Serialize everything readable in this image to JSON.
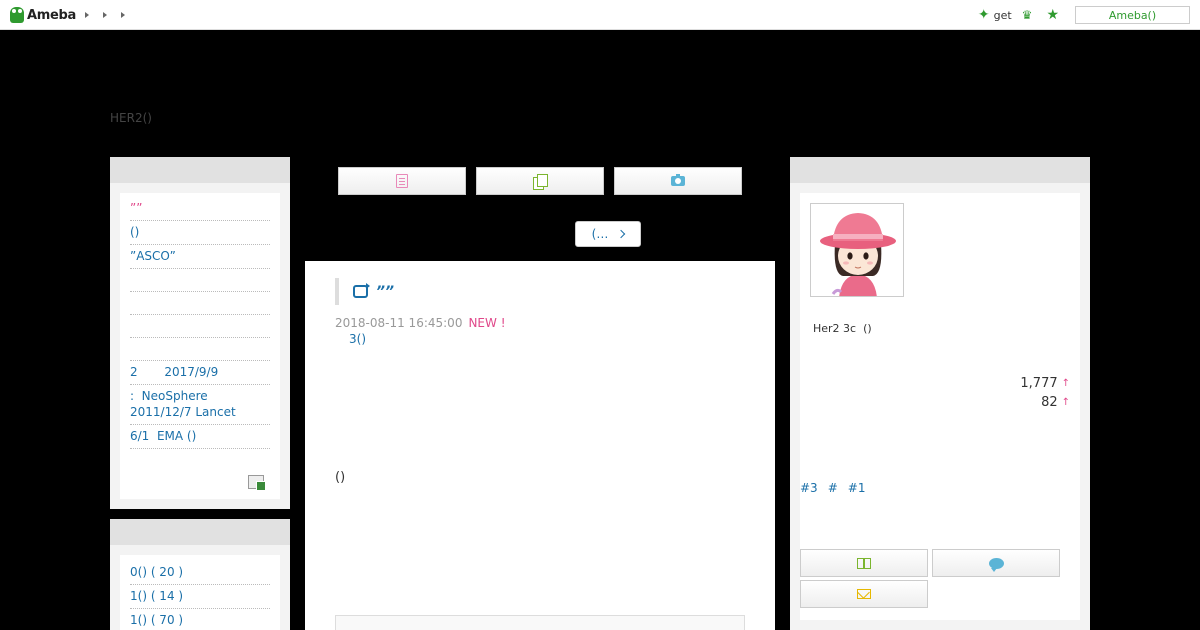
{
  "topbar": {
    "logo_text": "Ameba",
    "get_label": "get",
    "ameba_button_label": "Ameba()"
  },
  "blog": {
    "title": "HER2()"
  },
  "left_sidebar": {
    "links": [
      {
        "text": "””",
        "style": "pink"
      },
      {
        "text": "()",
        "style": "blue"
      },
      {
        "text": "”ASCO”",
        "style": "blue"
      },
      {
        "text": "",
        "style": "blue"
      },
      {
        "text": "",
        "style": "blue"
      },
      {
        "text": "",
        "style": "blue"
      },
      {
        "text": "",
        "style": "blue"
      },
      {
        "text": "2       2017/9/9",
        "style": "blue"
      },
      {
        "text": ":  NeoSphere 2011/12/7 Lancet",
        "style": "blue"
      },
      {
        "text": "6/1  EMA ()",
        "style": "blue"
      }
    ],
    "theme_links": [
      {
        "text": "0() ( 20 )"
      },
      {
        "text": "1() ( 14 )"
      },
      {
        "text": "1() ( 70 )"
      }
    ]
  },
  "nav": {
    "next_label": "(…"
  },
  "article": {
    "title": "””",
    "datetime": "2018-08-11 16:45:00",
    "new_badge": "NEW !",
    "theme": "3()",
    "body": "()"
  },
  "profile": {
    "name": "Her2 3c  ()",
    "stat_1": "1,777",
    "stat_2": "82",
    "tags": [
      "#3",
      "#",
      "#1"
    ]
  },
  "colors": {
    "link": "#1a6fa8",
    "accent_pink": "#e0488a",
    "ameba_green": "#2f9a2f"
  }
}
